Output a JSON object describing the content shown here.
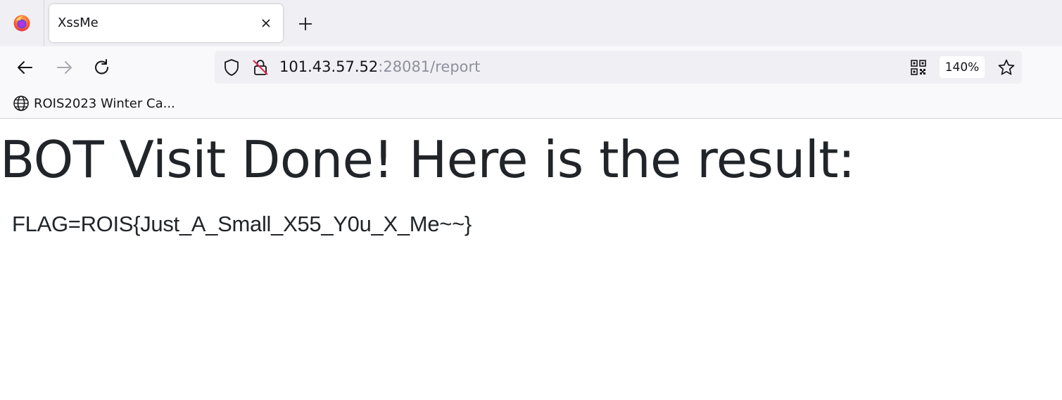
{
  "browser": {
    "tab": {
      "title": "XssMe"
    },
    "url": {
      "host": "101.43.57.52",
      "rest": ":28081/report"
    },
    "zoom": "140%",
    "bookmarks": [
      {
        "label": "ROIS2023 Winter Ca..."
      }
    ]
  },
  "page": {
    "heading": "BOT Visit Done! Here is the result:",
    "result": "FLAG=ROIS{Just_A_Small_X55_Y0u_X_Me~~}"
  },
  "colors": {
    "tabbar_bg": "#f0f0f4",
    "toolbar_bg": "#f9f9fb",
    "text": "#212529",
    "url_dim": "#8f8f9d"
  }
}
